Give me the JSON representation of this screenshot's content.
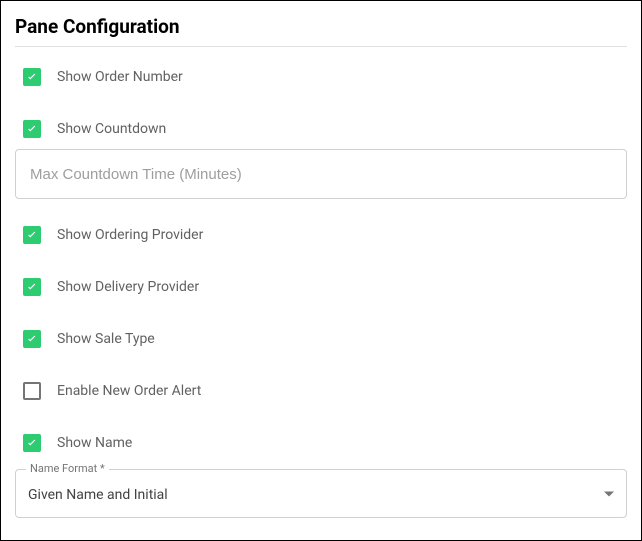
{
  "title": "Pane Configuration",
  "options": {
    "showOrderNumber": {
      "label": "Show Order Number",
      "checked": true
    },
    "showCountdown": {
      "label": "Show Countdown",
      "checked": true
    },
    "showOrderingProv": {
      "label": "Show Ordering Provider",
      "checked": true
    },
    "showDeliveryProv": {
      "label": "Show Delivery Provider",
      "checked": true
    },
    "showSaleType": {
      "label": "Show Sale Type",
      "checked": true
    },
    "enableNewAlert": {
      "label": "Enable New Order Alert",
      "checked": false
    },
    "showName": {
      "label": "Show Name",
      "checked": true
    }
  },
  "maxCountdown": {
    "placeholder": "Max Countdown Time (Minutes)",
    "value": ""
  },
  "nameFormat": {
    "label": "Name Format *",
    "value": "Given Name and Initial"
  }
}
